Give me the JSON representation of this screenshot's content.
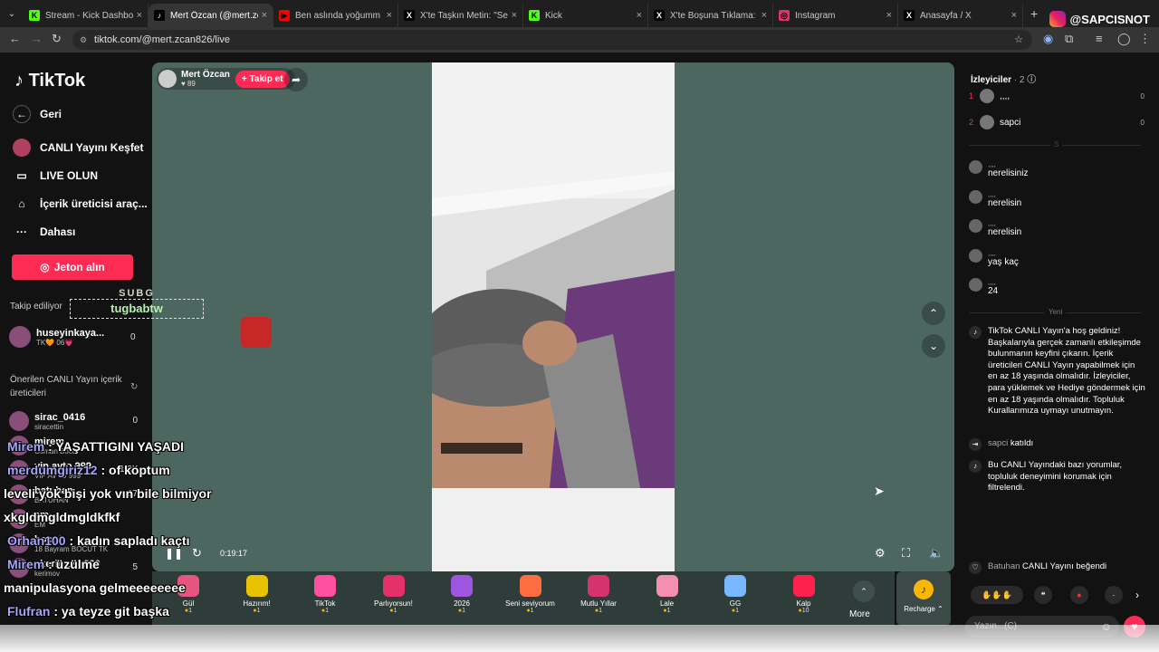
{
  "browser": {
    "tabs": [
      {
        "title": "Stream - Kick Dashboard",
        "fav": "K",
        "color": "#53fc18"
      },
      {
        "title": "Mert Özcan (@mert.zc",
        "fav": "♪",
        "color": "#000"
      },
      {
        "title": "Ben aslında yoğumm ben",
        "fav": "▶",
        "color": "#ff0000"
      },
      {
        "title": "X'te Taşkın Metin: \"Sevgili",
        "fav": "X",
        "color": "#000"
      },
      {
        "title": "Kick",
        "fav": "K",
        "color": "#53fc18"
      },
      {
        "title": "X'te Boşuna Tıklama: \"Ork",
        "fav": "X",
        "color": "#000"
      },
      {
        "title": "Instagram",
        "fav": "◎",
        "color": "#e1306c"
      },
      {
        "title": "Anasayfa / X",
        "fav": "X",
        "color": "#000"
      }
    ],
    "url": "tiktok.com/@mert.zcan826/live"
  },
  "brand": {
    "insta_handle": "@SAPCISNOT",
    "logo": "TikTok"
  },
  "nav": {
    "back": "Geri",
    "explore": "CANLI Yayını Keşfet",
    "go_live": "LIVE OLUN",
    "creator_tools": "İçerik üreticisi araç...",
    "more": "Dahası",
    "coins_button": "Jeton alın"
  },
  "following": {
    "label": "Takip ediliyor",
    "users": [
      {
        "name": "huseyinkaya...",
        "sub": "TK🧡 06💗",
        "count": "0"
      }
    ]
  },
  "suggested": {
    "label": "Önerilen CANLI Yayın içerik üreticileri",
    "users": [
      {
        "name": "sirac_0416",
        "sub": "siracettin",
        "count": "0"
      },
      {
        "name": "mirem",
        "sub": "Osman Bocu",
        "count": ""
      },
      {
        "name": "vip.avto.999",
        "sub": "VIP AVTO 999",
        "count": "1.9K"
      },
      {
        "name": "batuhan",
        "sub": "BATUHAN",
        "count": "97"
      },
      {
        "name": "em",
        "sub": "EM",
        "count": ""
      },
      {
        "name": "bocut",
        "sub": "18 Bayram BOCUT TK",
        "count": "1"
      },
      {
        "name": "_kerimov_330",
        "sub": "kerimov",
        "count": "5"
      }
    ]
  },
  "stream": {
    "host_name": "Mert Özcan",
    "host_likes": "89",
    "follow_label": "+ Takip et",
    "time": "0:19:17",
    "subbg_label": "SUBG",
    "subbg_name": "tugbabtw"
  },
  "gifts": [
    {
      "name": "Gül",
      "cost": "1",
      "color": "#e75480"
    },
    {
      "name": "Hazırım!",
      "cost": "1",
      "color": "#e6c200"
    },
    {
      "name": "TikTok",
      "cost": "1",
      "color": "#ff4fa3"
    },
    {
      "name": "Parlıyorsun!",
      "cost": "1",
      "color": "#e5316b"
    },
    {
      "name": "2026",
      "cost": "1",
      "color": "#a055e0"
    },
    {
      "name": "Seni seviyorum",
      "cost": "1",
      "color": "#ff6e40"
    },
    {
      "name": "Mutlu Yıllar",
      "cost": "1",
      "color": "#d6336c"
    },
    {
      "name": "Lale",
      "cost": "1",
      "color": "#f48fb1"
    },
    {
      "name": "GG",
      "cost": "1",
      "color": "#79b8ff"
    },
    {
      "name": "Kalp",
      "cost": "10",
      "color": "#ff2050"
    }
  ],
  "gift_more": "More",
  "recharge": "Recharge",
  "viewers": {
    "title": "İzleyiciler",
    "count": "· 2",
    "list": [
      {
        "rank": "1",
        "name": ",,,,",
        "score": "0"
      },
      {
        "rank": "2",
        "name": "sapci",
        "score": "0"
      }
    ]
  },
  "chat_divider": "S",
  "new_divider": "Yeni",
  "comments": [
    {
      "user": ",,,,",
      "text": "nerelisiniz"
    },
    {
      "user": ",,,,",
      "text": "nerelisin"
    },
    {
      "user": ",,,,",
      "text": "nerelisin"
    },
    {
      "user": ",,,,",
      "text": "yaş kaç"
    },
    {
      "user": ",,,,",
      "text": "24"
    }
  ],
  "system": {
    "welcome": "TikTok CANLI Yayın'a hoş geldiniz! Başkalarıyla gerçek zamanlı etkileşimde bulunmanın keyfini çıkarın. İçerik üreticileri CANLI Yayın yapabilmek için en az 18 yaşında olmalıdır. İzleyiciler, para yüklemek ve Hediye göndermek için en az 18 yaşında olmalıdır. Topluluk Kurallarımıza uymayı unutmayın.",
    "joined_user": "sapci",
    "joined": "katıldı",
    "filtered": "Bu CANLI Yayındaki bazı yorumlar, topluluk deneyimini korumak için filtrelendi.",
    "liked_user": "Batuhan",
    "liked": "CANLI Yayını beğendi"
  },
  "input_placeholder": "Yazın...(C)",
  "overlay_chat": [
    {
      "name": "Mirem",
      "text": " : YAŞATTIGINI YAŞADI"
    },
    {
      "name": "merdumgiriz12",
      "text": " : of koptum"
    },
    {
      "name": "",
      "text": "leveli yok bişi yok vın bile bilmiyor"
    },
    {
      "name": "",
      "text": "xkgldmgldmgldkfkf"
    },
    {
      "name": "Orhan100",
      "text": " : kadın sapladı kaçtı"
    },
    {
      "name": "Mirem",
      "text": " : üzülme"
    },
    {
      "name": "",
      "text": "manipulasyona gelmeeeeeeee"
    },
    {
      "name": "Flufran",
      "text": " : ya teyze git başka"
    }
  ]
}
